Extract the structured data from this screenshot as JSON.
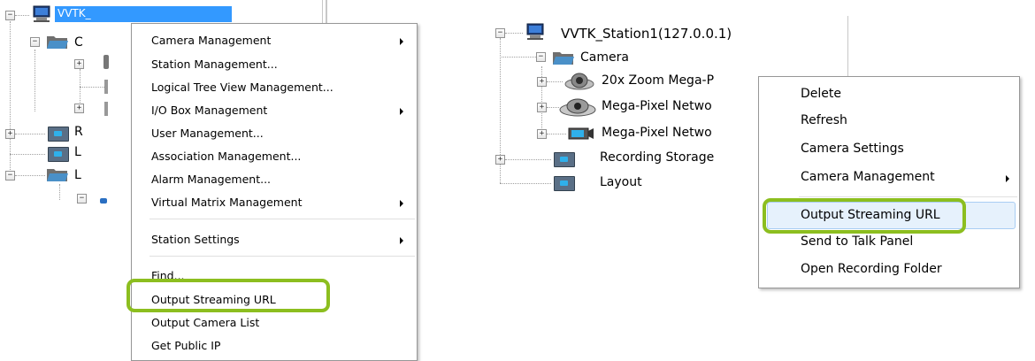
{
  "left": {
    "station_label": "VVTK_",
    "children_labels": [
      "C",
      "R",
      "L",
      "L"
    ],
    "menu": {
      "items": [
        {
          "label": "Camera Management",
          "submenu": true
        },
        {
          "label": "Station Management...",
          "submenu": false
        },
        {
          "label": "Logical Tree View Management...",
          "submenu": false
        },
        {
          "label": "I/O Box Management",
          "submenu": true
        },
        {
          "label": "User Management...",
          "submenu": false
        },
        {
          "label": "Association Management...",
          "submenu": false
        },
        {
          "label": "Alarm Management...",
          "submenu": false
        },
        {
          "label": "Virtual Matrix Management",
          "submenu": true
        },
        {
          "label": "Station Settings",
          "submenu": true
        },
        {
          "label": "Find...",
          "submenu": false
        },
        {
          "label": "Output Streaming URL",
          "submenu": false,
          "highlighted": true
        },
        {
          "label": "Output Camera List",
          "submenu": false
        },
        {
          "label": "Get Public IP",
          "submenu": false
        }
      ]
    }
  },
  "right": {
    "station_label": "VVTK_Station1(127.0.0.1)",
    "camera_folder_label": "Camera",
    "cameras": [
      "20x Zoom Mega-P",
      "Mega-Pixel Netwo",
      "Mega-Pixel Netwo"
    ],
    "recording_storage_label": "Recording Storage",
    "layout_label": "Layout",
    "menu": {
      "items": [
        {
          "label": "Delete",
          "submenu": false
        },
        {
          "label": "Refresh",
          "submenu": false
        },
        {
          "label": "Camera Settings",
          "submenu": false
        },
        {
          "label": "Camera Management",
          "submenu": true
        },
        {
          "label": "Output Streaming URL",
          "submenu": false,
          "highlighted": true
        },
        {
          "label": "Send to Talk Panel",
          "submenu": false
        },
        {
          "label": "Open Recording Folder",
          "submenu": false
        }
      ]
    }
  },
  "colors": {
    "highlight_outline": "#8cbe1f",
    "selection": "#3399ff",
    "folder": "#4a90c8"
  }
}
